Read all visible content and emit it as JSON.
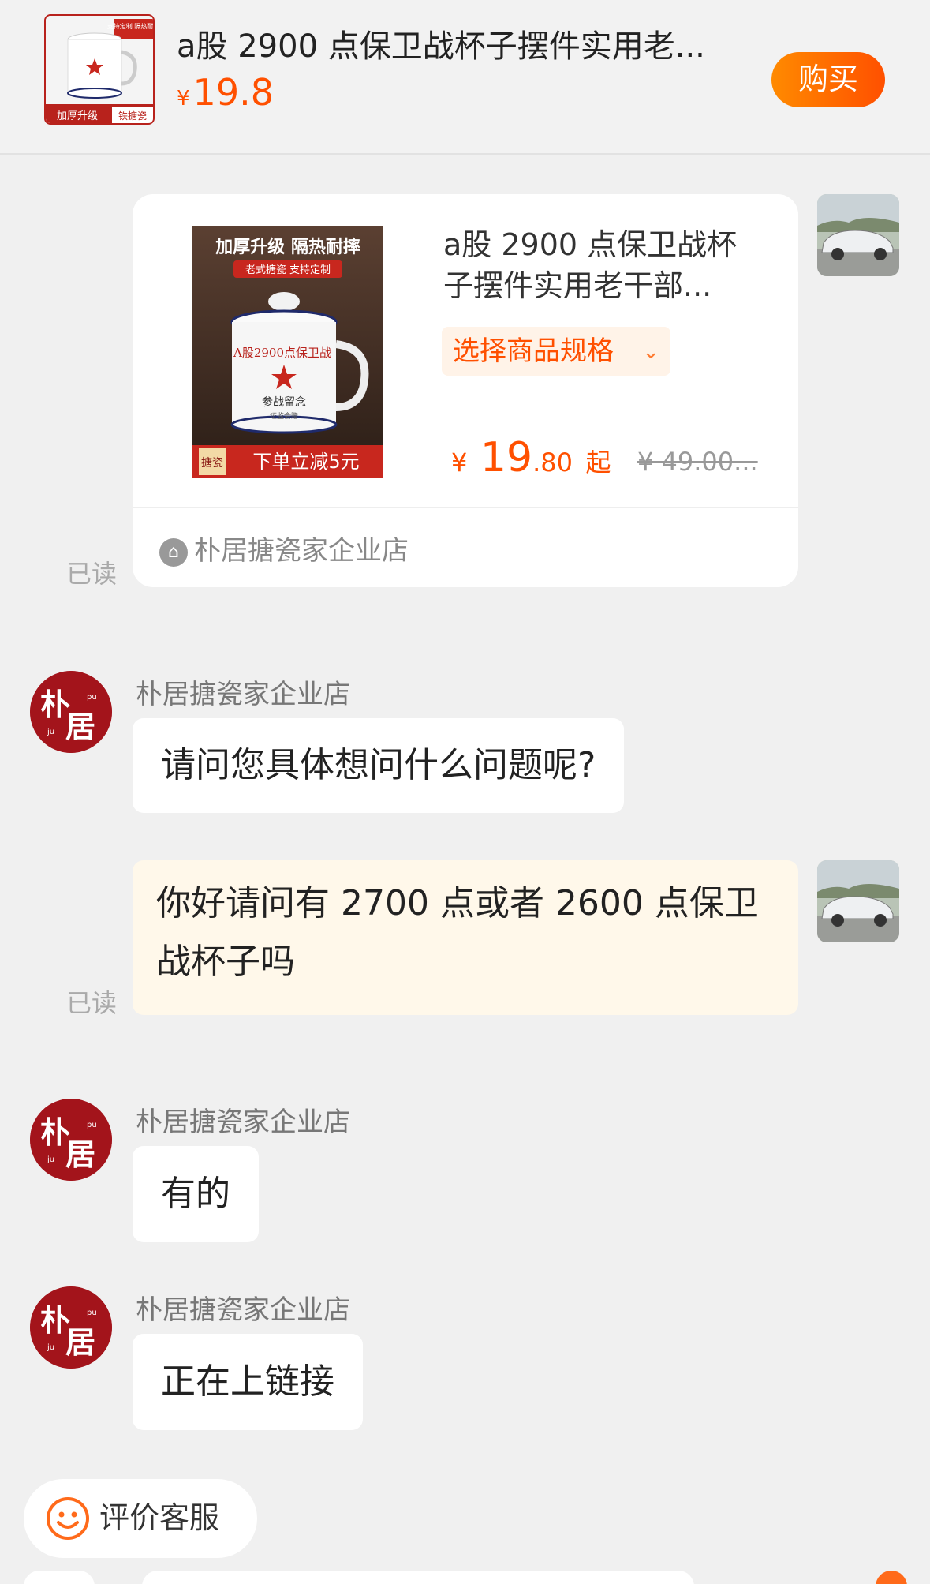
{
  "product_bar": {
    "thumb_badge_top": "支持定制 隔热耐摔",
    "thumb_badge_bottom_1": "加厚升级",
    "thumb_badge_bottom_2": "铁搪瓷",
    "title": "a股 2900 点保卫战杯子摆件实用老...",
    "price_currency": "¥",
    "price": "19.8",
    "buy_label": "购买"
  },
  "product_card": {
    "image_top_banner": "加厚升级 隔热耐摔",
    "image_sub_banner": "老式搪瓷 支持定制",
    "mug_text_line1": "A股2900点保卫战",
    "mug_text_line2": "参战留念",
    "mug_text_line3": "证监会赠",
    "image_corner_tag": "搪瓷",
    "image_promo": "下单立减5元",
    "title": "a股 2900 点保卫战杯子摆件实用老干部...",
    "spec_label": "选择商品规格",
    "price_currency": "¥",
    "price_int": "19",
    "price_dec": ".80",
    "price_suffix": "起",
    "original_price": "¥ 49.00...",
    "shop_name": "朴居搪瓷家企业店"
  },
  "shop_avatar": {
    "char1": "朴",
    "char2": "居",
    "pinyin1": "pu",
    "pinyin2": "ju"
  },
  "read_label": "已读",
  "messages": [
    {
      "sender": "朴居搪瓷家企业店",
      "text": "请问您具体想问什么问题呢?"
    },
    {
      "sender": "",
      "text": "你好请问有 2700 点或者 2600 点保卫战杯子吗"
    },
    {
      "sender": "朴居搪瓷家企业店",
      "text": "有的"
    },
    {
      "sender": "朴居搪瓷家企业店",
      "text": "正在上链接"
    }
  ],
  "rate_button_label": "评价客服",
  "colors": {
    "accent": "#ff5000",
    "shop_red": "#a3141b",
    "background": "#f0f0f0",
    "my_bubble": "#fff8ea"
  }
}
